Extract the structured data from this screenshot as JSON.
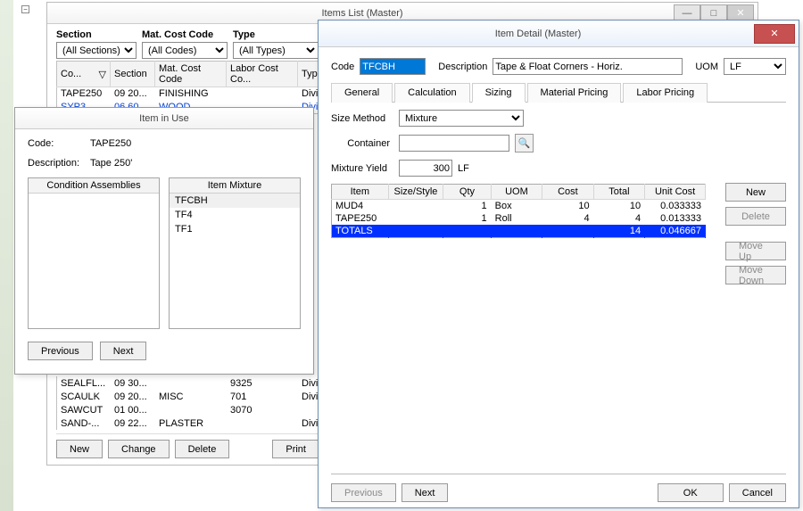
{
  "items_list": {
    "title": "Items List (Master)",
    "filters": {
      "section_label": "Section",
      "section_value": "(All Sections)",
      "cost_label": "Mat. Cost Code",
      "cost_value": "(All Codes)",
      "type_label": "Type",
      "type_value": "(All Types)"
    },
    "headers": {
      "code": "Co...",
      "section": "Section",
      "mat": "Mat. Cost Code",
      "labor": "Labor Cost Co...",
      "type": "Type"
    },
    "rows_top": [
      {
        "code": "TAPE250",
        "section": "09 20...",
        "mat": "FINISHING",
        "labor": "",
        "type": "Divisio"
      },
      {
        "code": "SYP3",
        "section": "06 60...",
        "mat": "WOOD",
        "labor": "",
        "type": "Divisio",
        "link": true
      }
    ],
    "rows_bottom": [
      {
        "code": "SEALFL...",
        "section": "09 30...",
        "mat": "",
        "labor": "9325",
        "type": "Divisio"
      },
      {
        "code": "SCAULK",
        "section": "09 20...",
        "mat": "MISC",
        "labor": "701",
        "type": "Divisio"
      },
      {
        "code": "SAWCUT",
        "section": "01 00...",
        "mat": "",
        "labor": "3070",
        "type": ""
      },
      {
        "code": "SAND-...",
        "section": "09 22...",
        "mat": "PLASTER",
        "labor": "",
        "type": "Divisio"
      }
    ],
    "buttons": {
      "new": "New",
      "change": "Change",
      "delete": "Delete",
      "print": "Print"
    }
  },
  "item_in_use": {
    "title": "Item in Use",
    "code_label": "Code:",
    "code_value": "TAPE250",
    "desc_label": "Description:",
    "desc_value": "Tape 250'",
    "list1_title": "Condition Assemblies",
    "list2_title": "Item Mixture",
    "mixture": [
      "TFCBH",
      "TF4",
      "TF1"
    ],
    "previous": "Previous",
    "next": "Next"
  },
  "item_detail": {
    "title": "Item Detail (Master)",
    "code_label": "Code",
    "code_value": "TFCBH",
    "desc_label": "Description",
    "desc_value": "Tape & Float Corners - Horiz.",
    "uom_label": "UOM",
    "uom_value": "LF",
    "tabs": {
      "general": "General",
      "calculation": "Calculation",
      "sizing": "Sizing",
      "material": "Material Pricing",
      "labor": "Labor Pricing"
    },
    "size_method_label": "Size Method",
    "size_method_value": "Mixture",
    "container_label": "Container",
    "container_value": "",
    "yield_label": "Mixture Yield",
    "yield_value": "300",
    "yield_uom": "LF",
    "grid_headers": {
      "item": "Item",
      "size": "Size/Style",
      "qty": "Qty",
      "uom": "UOM",
      "cost": "Cost",
      "total": "Total",
      "unitcost": "Unit Cost"
    },
    "rows": [
      {
        "item": "MUD4",
        "size": "",
        "qty": "1",
        "uom": "Box",
        "cost": "10",
        "total": "10",
        "unit": "0.033333"
      },
      {
        "item": "TAPE250",
        "size": "",
        "qty": "1",
        "uom": "Roll",
        "cost": "4",
        "total": "4",
        "unit": "0.013333"
      }
    ],
    "totals": {
      "label": "TOTALS",
      "total": "14",
      "unit": "0.046667"
    },
    "side": {
      "new": "New",
      "delete": "Delete",
      "moveup": "Move Up",
      "movedown": "Move Down"
    },
    "previous": "Previous",
    "next": "Next",
    "ok": "OK",
    "cancel": "Cancel"
  }
}
